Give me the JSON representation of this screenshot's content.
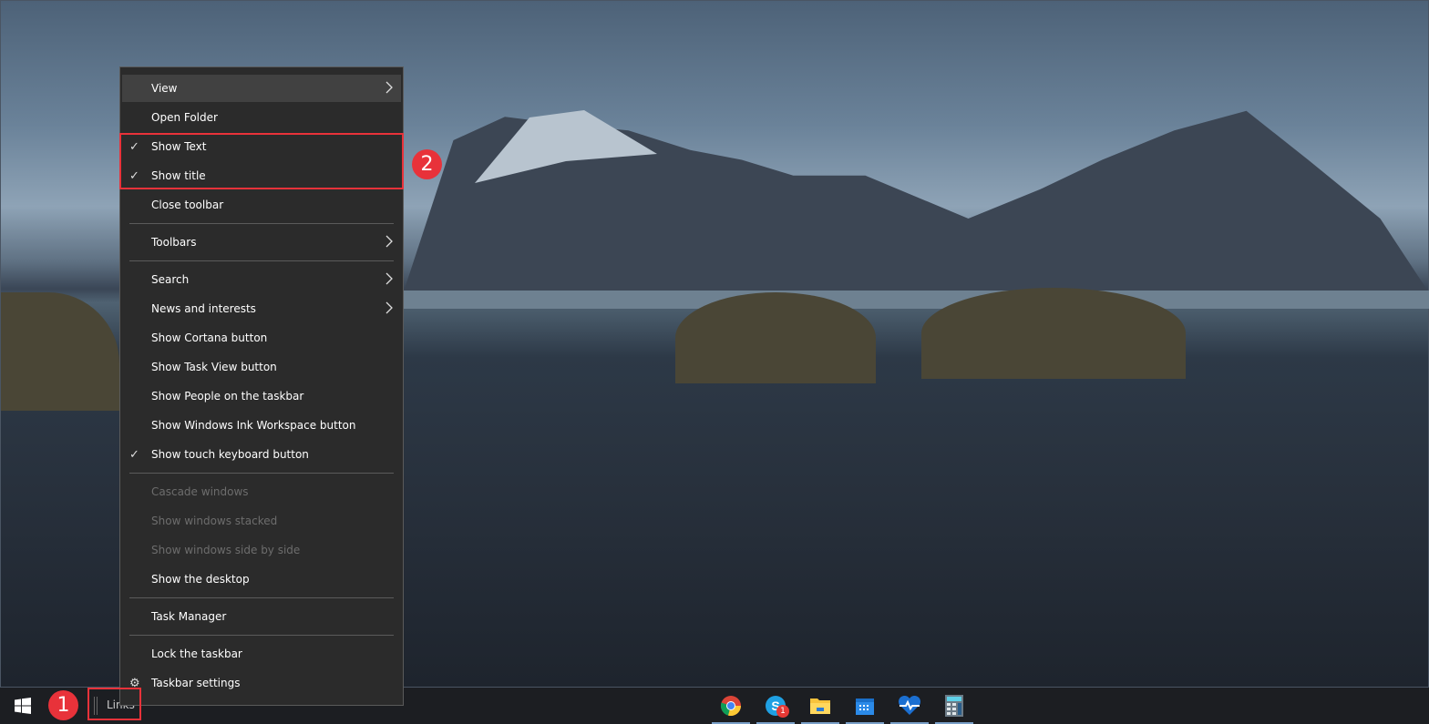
{
  "menu": {
    "items": [
      {
        "label": "View",
        "submenu": true,
        "highlighted": true
      },
      {
        "label": "Open Folder"
      },
      {
        "label": "Show Text",
        "checked": true
      },
      {
        "label": "Show title",
        "checked": true
      },
      {
        "label": "Close toolbar"
      },
      {
        "label": "Toolbars",
        "submenu": true
      },
      {
        "label": "Search",
        "submenu": true
      },
      {
        "label": "News and interests",
        "submenu": true
      },
      {
        "label": "Show Cortana button"
      },
      {
        "label": "Show Task View button"
      },
      {
        "label": "Show People on the taskbar"
      },
      {
        "label": "Show Windows Ink Workspace button"
      },
      {
        "label": "Show touch keyboard button",
        "checked": true
      },
      {
        "label": "Cascade windows",
        "disabled": true
      },
      {
        "label": "Show windows stacked",
        "disabled": true
      },
      {
        "label": "Show windows side by side",
        "disabled": true
      },
      {
        "label": "Show the desktop"
      },
      {
        "label": "Task Manager"
      },
      {
        "label": "Lock the taskbar"
      },
      {
        "label": "Taskbar settings",
        "icon": "gear-icon"
      }
    ],
    "check_glyph": "✓"
  },
  "taskbar": {
    "toolbar_label": "Links",
    "skype_badge": "1",
    "apps": [
      "chrome",
      "skype",
      "file-explorer",
      "calendar",
      "health",
      "calculator"
    ]
  },
  "annotations": {
    "step1": "1",
    "step2": "2",
    "color": "#e8323a"
  }
}
